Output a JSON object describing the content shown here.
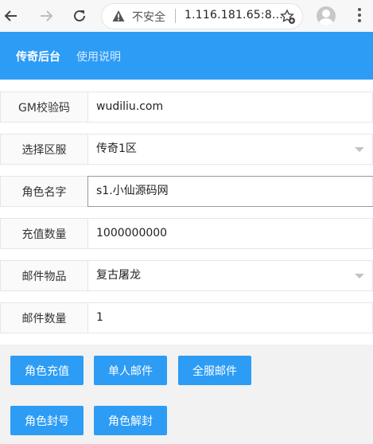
{
  "browser": {
    "insecure_label": "不安全",
    "url": "1.116.181.65:8..."
  },
  "header": {
    "brand": "传奇后台",
    "help": "使用说明"
  },
  "form": {
    "gm_code": {
      "label": "GM校验码",
      "value": "wudiliu.com"
    },
    "server": {
      "label": "选择区服",
      "value": "传奇1区"
    },
    "role_name": {
      "label": "角色名字",
      "value": "s1.小仙源码网"
    },
    "recharge_amount": {
      "label": "充值数量",
      "value": "1000000000"
    },
    "mail_item": {
      "label": "邮件物品",
      "value": "复古屠龙"
    },
    "mail_count": {
      "label": "邮件数量",
      "value": "1"
    }
  },
  "buttons": {
    "recharge": "角色充值",
    "single_mail": "单人邮件",
    "all_mail": "全服邮件",
    "ban": "角色封号",
    "unban": "角色解封"
  },
  "colors": {
    "accent": "#2d9cf5",
    "panel": "#f2f2f2"
  },
  "icons": [
    "back-arrow-icon",
    "forward-arrow-icon",
    "reload-icon",
    "warning-icon",
    "bookmark-star-icon",
    "profile-avatar-icon",
    "menu-dots-icon",
    "dropdown-caret-icon"
  ]
}
